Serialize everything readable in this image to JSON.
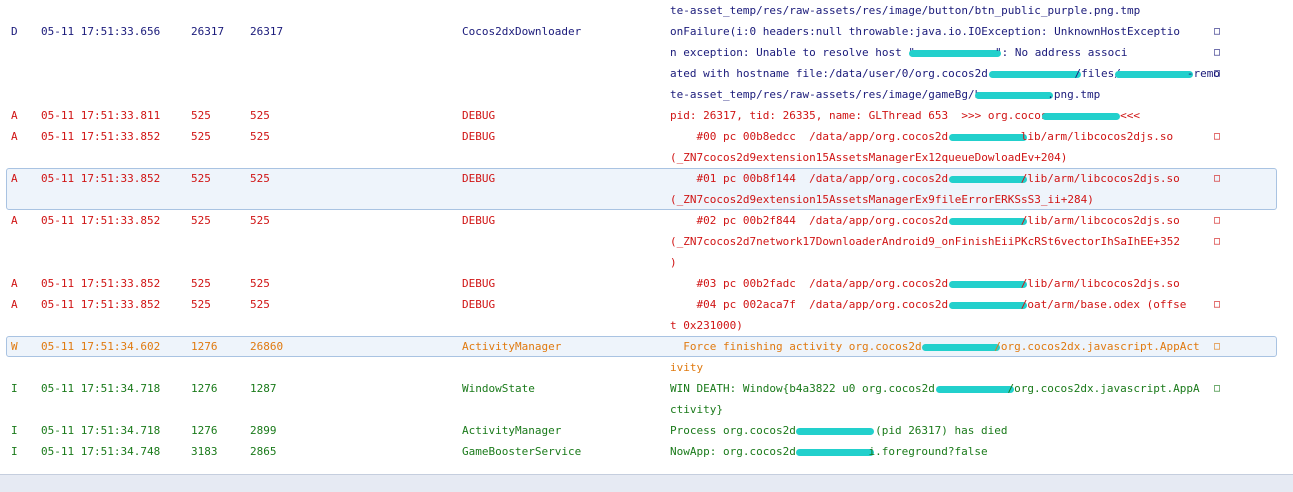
{
  "colors": {
    "D": "#1a1a7a",
    "A": "#d01414",
    "W": "#e07a10",
    "I": "#1a7a1a",
    "redaction": "#22d0cc"
  },
  "rows": [
    {
      "level": "",
      "time": "",
      "pid": "",
      "tid": "",
      "tag": "",
      "msg": "te-asset_temp/res/raw-assets/res/image/button/btn_public_purple.png.tmp",
      "cont": false,
      "color": "D"
    },
    {
      "level": "D",
      "time": "05-11 17:51:33.656",
      "pid": "26317",
      "tid": "26317",
      "tag": "Cocos2dxDownloader",
      "msg": "onFailure(i:0 headers:null throwable:java.io.IOException: UnknownHostExceptio",
      "cont": true,
      "color": "D"
    },
    {
      "level": "",
      "time": "",
      "pid": "",
      "tid": "",
      "tag": "",
      "msg": "n exception: Unable to resolve host \"[R]\": No address associ",
      "cont": true,
      "color": "D"
    },
    {
      "level": "",
      "time": "",
      "pid": "",
      "tid": "",
      "tag": "",
      "msg": "ated with hostname file:/data/user/0/org.cocos2d.[R]/files/[R]-remo",
      "cont": true,
      "color": "D"
    },
    {
      "level": "",
      "time": "",
      "pid": "",
      "tid": "",
      "tag": "",
      "msg": "te-asset_temp/res/raw-assets/res/image/gameBg/b[R].png.tmp",
      "cont": false,
      "color": "D"
    },
    {
      "level": "A",
      "time": "05-11 17:51:33.811",
      "pid": "525",
      "tid": "525",
      "tag": "DEBUG",
      "msg": "pid: 26317, tid: 26335, name: GLThread 653  >>> org.cocos[R] <<<",
      "cont": false,
      "color": "A"
    },
    {
      "level": "A",
      "time": "05-11 17:51:33.852",
      "pid": "525",
      "tid": "525",
      "tag": "DEBUG",
      "msg": "    #00 pc 00b8edcc  /data/app/org.cocos2d.[R]lib/arm/libcocos2djs.so",
      "cont": true,
      "color": "A"
    },
    {
      "level": "",
      "time": "",
      "pid": "",
      "tid": "",
      "tag": "",
      "msg": "(_ZN7cocos2d9extension15AssetsManagerEx12queueDowloadEv+204)",
      "cont": false,
      "color": "A"
    },
    {
      "level": "A",
      "time": "05-11 17:51:33.852",
      "pid": "525",
      "tid": "525",
      "tag": "DEBUG",
      "msg": "    #01 pc 00b8f144  /data/app/org.cocos2d.[R]/lib/arm/libcocos2djs.so",
      "cont": true,
      "color": "A",
      "selected": "top"
    },
    {
      "level": "",
      "time": "",
      "pid": "",
      "tid": "",
      "tag": "",
      "msg": "(_ZN7cocos2d9extension15AssetsManagerEx9fileErrorERKSsS3_ii+284)",
      "cont": false,
      "color": "A"
    },
    {
      "level": "A",
      "time": "05-11 17:51:33.852",
      "pid": "525",
      "tid": "525",
      "tag": "DEBUG",
      "msg": "    #02 pc 00b2f844  /data/app/org.cocos2d.[R]/lib/arm/libcocos2djs.so",
      "cont": true,
      "color": "A"
    },
    {
      "level": "",
      "time": "",
      "pid": "",
      "tid": "",
      "tag": "",
      "msg": "(_ZN7cocos2d7network17DownloaderAndroid9_onFinishEiiPKcRSt6vectorIhSaIhEE+352",
      "cont": true,
      "color": "A"
    },
    {
      "level": "",
      "time": "",
      "pid": "",
      "tid": "",
      "tag": "",
      "msg": ")",
      "cont": false,
      "color": "A"
    },
    {
      "level": "A",
      "time": "05-11 17:51:33.852",
      "pid": "525",
      "tid": "525",
      "tag": "DEBUG",
      "msg": "    #03 pc 00b2fadc  /data/app/org.cocos2d.[R]/lib/arm/libcocos2djs.so",
      "cont": false,
      "color": "A"
    },
    {
      "level": "A",
      "time": "05-11 17:51:33.852",
      "pid": "525",
      "tid": "525",
      "tag": "DEBUG",
      "msg": "    #04 pc 002aca7f  /data/app/org.cocos2d.[R]/oat/arm/base.odex (offse",
      "cont": true,
      "color": "A"
    },
    {
      "level": "",
      "time": "",
      "pid": "",
      "tid": "",
      "tag": "",
      "msg": "t 0x231000)",
      "cont": false,
      "color": "A"
    },
    {
      "level": "W",
      "time": "05-11 17:51:34.602",
      "pid": "1276",
      "tid": "26860",
      "tag": "ActivityManager",
      "msg": "  Force finishing activity org.cocos2d.[R]/org.cocos2dx.javascript.AppAct",
      "cont": true,
      "color": "W",
      "selected": "single"
    },
    {
      "level": "",
      "time": "",
      "pid": "",
      "tid": "",
      "tag": "",
      "msg": "ivity",
      "cont": false,
      "color": "W"
    },
    {
      "level": "I",
      "time": "05-11 17:51:34.718",
      "pid": "1276",
      "tid": "1287",
      "tag": "WindowState",
      "msg": "WIN DEATH: Window{b4a3822 u0 org.cocos2d.[R]/org.cocos2dx.javascript.AppA",
      "cont": true,
      "color": "I"
    },
    {
      "level": "",
      "time": "",
      "pid": "",
      "tid": "",
      "tag": "",
      "msg": "ctivity}",
      "cont": false,
      "color": "I"
    },
    {
      "level": "I",
      "time": "05-11 17:51:34.718",
      "pid": "1276",
      "tid": "2899",
      "tag": "ActivityManager",
      "msg": "Process org.cocos2d.[R] (pid 26317) has died",
      "cont": false,
      "color": "I"
    },
    {
      "level": "I",
      "time": "05-11 17:51:34.748",
      "pid": "3183",
      "tid": "2865",
      "tag": "GameBoosterService",
      "msg": "NowApp: org.cocos2d.[R]i.foreground?false",
      "cont": false,
      "color": "I"
    }
  ],
  "cont_glyph": "□"
}
